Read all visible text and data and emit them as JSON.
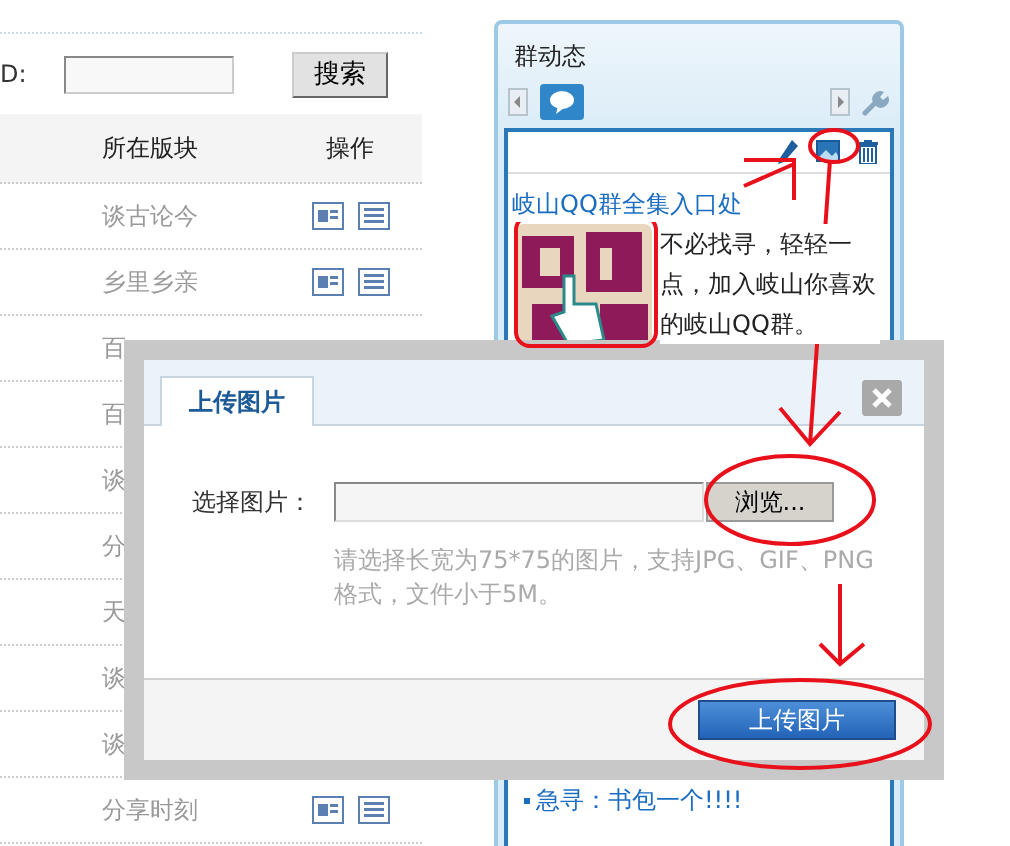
{
  "search": {
    "label": "D:",
    "button": "搜索"
  },
  "table": {
    "columns": [
      "所在版块",
      "操作"
    ],
    "rows": [
      {
        "board": "谈古论今",
        "actions": true
      },
      {
        "board": "乡里乡亲",
        "actions": true
      },
      {
        "board": "百",
        "actions": false
      },
      {
        "board": "百",
        "actions": false
      },
      {
        "board": "谈",
        "actions": false
      },
      {
        "board": "分",
        "actions": false
      },
      {
        "board": "天",
        "actions": false
      },
      {
        "board": "谈",
        "actions": false
      },
      {
        "board": "谈",
        "actions": false
      },
      {
        "board": "分享时刻",
        "actions": true
      }
    ]
  },
  "panel": {
    "title": "群动态",
    "post": {
      "title": "岐山QQ群全集入口处",
      "text": "不必找寻，轻轻一点，加入岐山你喜欢的岐山QQ群。"
    },
    "next_item": "急寻：书包一个!!!!"
  },
  "dialog": {
    "tab": "上传图片",
    "field_label": "选择图片：",
    "browse_button": "浏览...",
    "hint": "请选择长宽为75*75的图片，支持JPG、GIF、PNG格式，文件小于5M。",
    "submit_button": "上传图片"
  }
}
